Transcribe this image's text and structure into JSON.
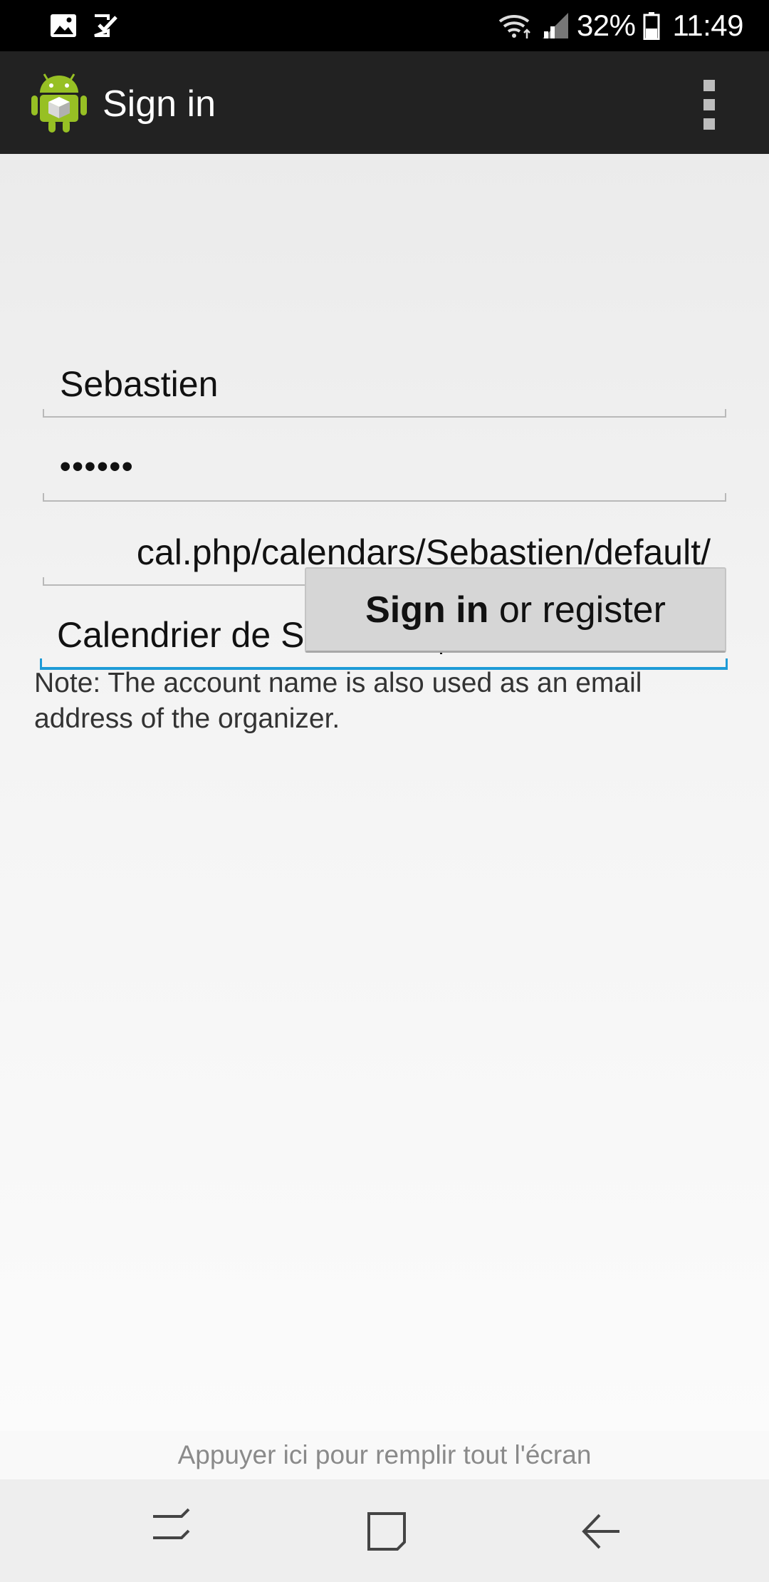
{
  "status_bar": {
    "icons": [
      "image-icon",
      "checkbox-icon",
      "wifi-icon",
      "signal-icon",
      "battery-icon"
    ],
    "battery_percent": "32%",
    "time": "11:49"
  },
  "app_bar": {
    "title": "Sign in",
    "logo_icon": "android-robot-icon",
    "overflow_icon": "overflow-menu-icon"
  },
  "form": {
    "username": "Sebastien",
    "password_masked": "••••••",
    "url_visible": "cal.php/calendars/Sebastien/default/",
    "calendar_name": "Calendrier de Sébastien"
  },
  "button": {
    "bold_label": "Sign in",
    "rest_label": "or register"
  },
  "note": "Note: The account name is also used as an email address of the organizer.",
  "fullscreen_hint": "Appuyer ici pour remplir tout l'écran",
  "nav_bar": {
    "buttons": [
      "recents-icon",
      "home-icon",
      "back-icon"
    ]
  },
  "colors": {
    "status_bar": "#000000",
    "app_bar": "#222222",
    "focus_accent": "#1e9bd7",
    "button_bg": "#d6d6d6",
    "android_green": "#97c024"
  }
}
